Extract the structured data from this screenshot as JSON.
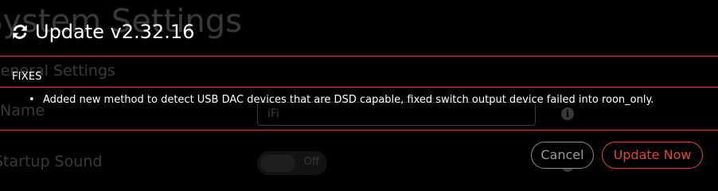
{
  "background": {
    "page_title": "System Settings",
    "section_heading": "General Settings",
    "name_label": "Name",
    "name_value": "iFi",
    "sound_label": "Startup Sound",
    "sound_toggle": "Off",
    "info_icon": "info-circle-icon"
  },
  "modal": {
    "icon": "refresh-icon",
    "title": "Update v2.32.16",
    "fixes_heading": "FIXES",
    "fixes": [
      "Added new method to detect USB DAC devices that are DSD capable, fixed switch output device failed into roon_only."
    ],
    "cancel_label": "Cancel",
    "update_label": "Update Now"
  },
  "colors": {
    "accent": "#e0462f",
    "background": "#000000",
    "text": "#ffffff",
    "muted": "#9a9a9a"
  }
}
